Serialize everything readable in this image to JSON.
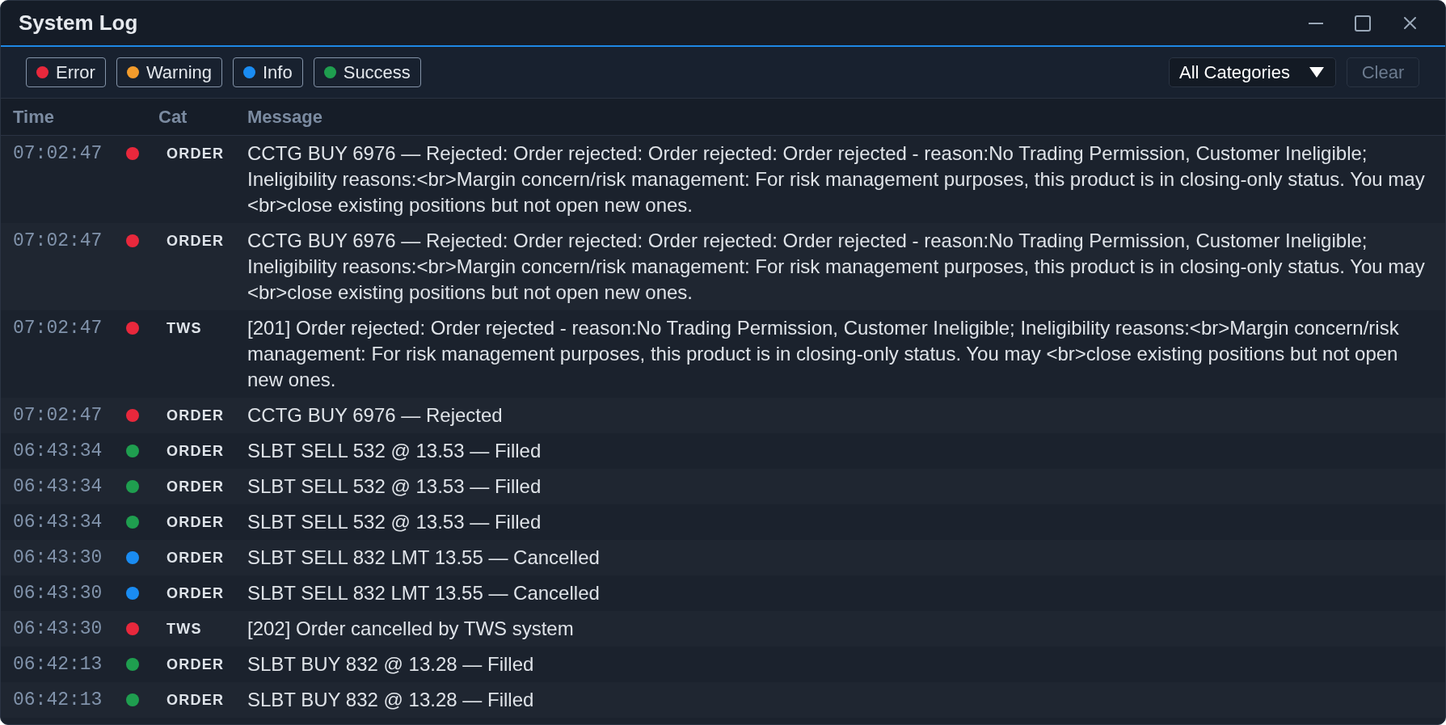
{
  "window": {
    "title": "System Log"
  },
  "toolbar": {
    "filters": [
      {
        "label": "Error",
        "color": "#e8283c"
      },
      {
        "label": "Warning",
        "color": "#f39c2c"
      },
      {
        "label": "Info",
        "color": "#1a8cf2"
      },
      {
        "label": "Success",
        "color": "#1f9e4f"
      }
    ],
    "category_filter": {
      "value": "All Categories"
    },
    "clear_button": {
      "label": "Clear",
      "disabled": true
    }
  },
  "table": {
    "columns": [
      "Time",
      "Cat",
      "Message"
    ],
    "rows": [
      {
        "time": "07:02:47",
        "color": "#e8283c",
        "category": "ORDER",
        "message": "CCTG BUY 6976 — Rejected: Order rejected: Order rejected: Order rejected - reason:No Trading Permission, Customer Ineligible; Ineligibility reasons:<br>Margin concern/risk management: For risk management purposes, this product is in closing-only status. You may <br>close existing positions but not open new ones."
      },
      {
        "time": "07:02:47",
        "color": "#e8283c",
        "category": "ORDER",
        "message": "CCTG BUY 6976 — Rejected: Order rejected: Order rejected: Order rejected - reason:No Trading Permission, Customer Ineligible; Ineligibility reasons:<br>Margin concern/risk management: For risk management purposes, this product is in closing-only status. You may <br>close existing positions but not open new ones."
      },
      {
        "time": "07:02:47",
        "color": "#e8283c",
        "category": "TWS",
        "message": "[201] Order rejected: Order rejected - reason:No Trading Permission, Customer Ineligible; Ineligibility reasons:<br>Margin concern/risk management: For risk management purposes, this product is in closing-only status. You may <br>close existing positions but not open new ones."
      },
      {
        "time": "07:02:47",
        "color": "#e8283c",
        "category": "ORDER",
        "message": "CCTG BUY 6976 — Rejected"
      },
      {
        "time": "06:43:34",
        "color": "#1f9e4f",
        "category": "ORDER",
        "message": "SLBT SELL 532 @ 13.53 — Filled"
      },
      {
        "time": "06:43:34",
        "color": "#1f9e4f",
        "category": "ORDER",
        "message": "SLBT SELL 532 @ 13.53 — Filled"
      },
      {
        "time": "06:43:34",
        "color": "#1f9e4f",
        "category": "ORDER",
        "message": "SLBT SELL 532 @ 13.53 — Filled"
      },
      {
        "time": "06:43:30",
        "color": "#1a8cf2",
        "category": "ORDER",
        "message": "SLBT SELL 832 LMT 13.55 — Cancelled"
      },
      {
        "time": "06:43:30",
        "color": "#1a8cf2",
        "category": "ORDER",
        "message": "SLBT SELL 832 LMT 13.55 — Cancelled"
      },
      {
        "time": "06:43:30",
        "color": "#e8283c",
        "category": "TWS",
        "message": "[202] Order cancelled by TWS system"
      },
      {
        "time": "06:42:13",
        "color": "#1f9e4f",
        "category": "ORDER",
        "message": "SLBT BUY 832 @ 13.28 — Filled"
      },
      {
        "time": "06:42:13",
        "color": "#1f9e4f",
        "category": "ORDER",
        "message": "SLBT BUY 832 @ 13.28 — Filled"
      }
    ]
  }
}
